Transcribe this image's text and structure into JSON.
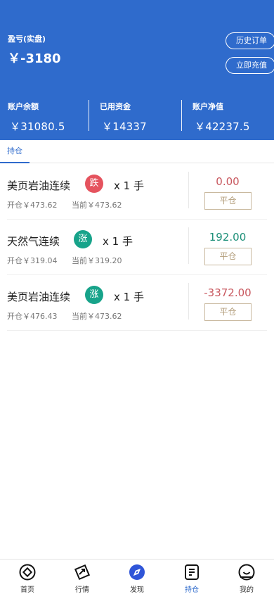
{
  "header": {
    "pl_label": "盈亏(实盘)",
    "pl_value": "￥-3180",
    "history_button": "历史订单",
    "recharge_button": "立即充值",
    "stats": [
      {
        "label": "账户余额",
        "value": "￥31080.5"
      },
      {
        "label": "已用资金",
        "value": "￥14337"
      },
      {
        "label": "账户净值",
        "value": "￥42237.5"
      }
    ]
  },
  "tabs": {
    "holding": "持仓"
  },
  "positions": [
    {
      "name": "美页岩油连续",
      "direction": "跌",
      "qty": "x 1 手",
      "open": "开仓￥473.62",
      "current": "当前￥473.62",
      "pnl": "0.00",
      "close": "平仓"
    },
    {
      "name": "天然气连续",
      "direction": "涨",
      "qty": "x 1 手",
      "open": "开仓￥319.04",
      "current": "当前￥319.20",
      "pnl": "192.00",
      "close": "平仓"
    },
    {
      "name": "美页岩油连续",
      "direction": "涨",
      "qty": "x 1 手",
      "open": "开仓￥476.43",
      "current": "当前￥473.62",
      "pnl": "-3372.00",
      "close": "平仓"
    }
  ],
  "nav": [
    {
      "label": "首页",
      "icon": "home-icon"
    },
    {
      "label": "行情",
      "icon": "market-icon"
    },
    {
      "label": "发现",
      "icon": "compass-icon"
    },
    {
      "label": "持仓",
      "icon": "position-icon"
    },
    {
      "label": "我的",
      "icon": "profile-icon"
    }
  ],
  "colors": {
    "brand": "#2f6bcc",
    "down": "#e5535e",
    "up": "#17a38a",
    "loss": "#c8575e",
    "gain": "#1c8f78"
  }
}
